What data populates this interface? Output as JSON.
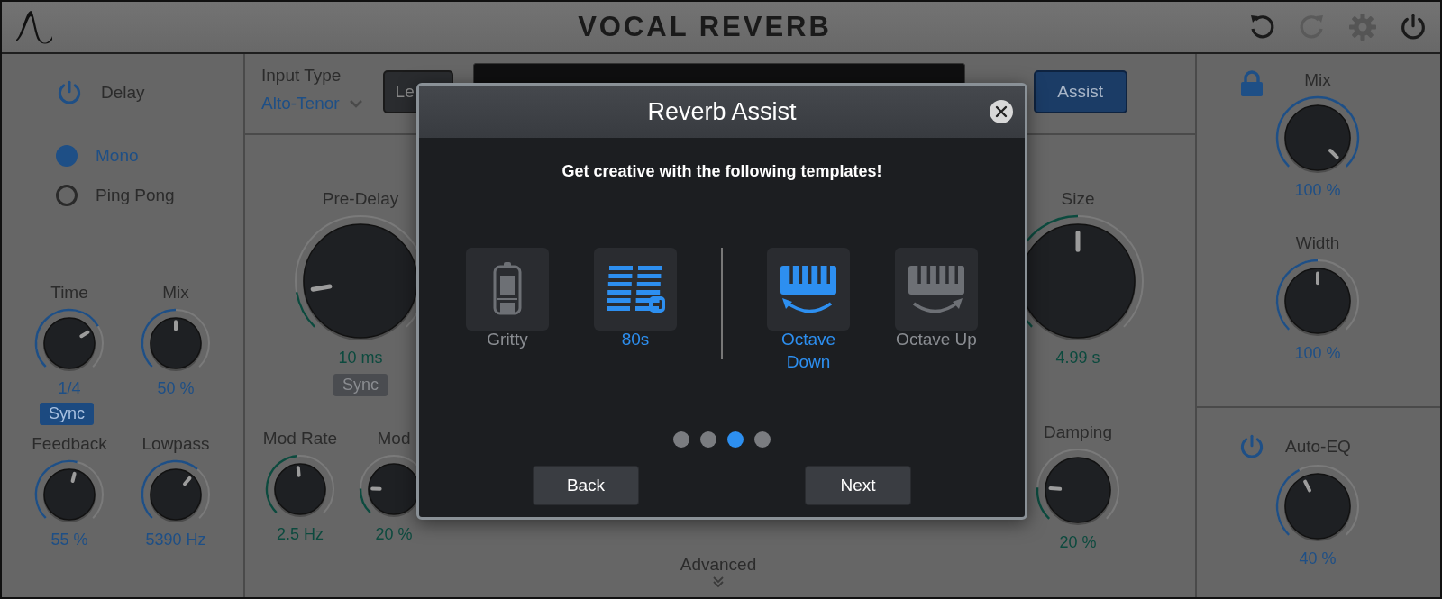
{
  "header": {
    "title": "VOCAL REVERB"
  },
  "delay": {
    "label": "Delay",
    "on": true,
    "modes": [
      {
        "label": "Mono",
        "selected": true
      },
      {
        "label": "Ping Pong",
        "selected": false
      }
    ],
    "knobs": [
      {
        "label": "Time",
        "value": "1/4"
      },
      {
        "label": "Mix",
        "value": "50 %"
      },
      {
        "label": "Feedback",
        "value": "55 %"
      },
      {
        "label": "Lowpass",
        "value": "5390 Hz"
      }
    ],
    "sync": {
      "label": "Sync",
      "on": true
    }
  },
  "input": {
    "label": "Input Type",
    "value": "Alto-Tenor",
    "learn": "Le",
    "assist": {
      "label": "Assist",
      "on": true
    }
  },
  "reverb": {
    "predelay": {
      "label": "Pre-Delay",
      "value": "10 ms"
    },
    "sync": {
      "label": "Sync",
      "on": false
    },
    "mod_knobs": [
      {
        "label": "Mod Rate",
        "value": "2.5 Hz"
      },
      {
        "label": "Mod",
        "value": "20 %"
      }
    ],
    "size": {
      "label": "Size",
      "value": "4.99 s"
    },
    "damping": {
      "label": "Damping",
      "value": "20 %"
    },
    "advanced": "Advanced"
  },
  "output": {
    "locked": true,
    "knobs": [
      {
        "label": "Mix",
        "value": "100 %"
      },
      {
        "label": "Width",
        "value": "100 %"
      }
    ],
    "auto_eq": {
      "label": "Auto-EQ",
      "on": true,
      "knob": {
        "value": "40 %"
      }
    }
  },
  "modal": {
    "title": "Reverb Assist",
    "subtitle": "Get creative with the following templates!",
    "templates": [
      {
        "label": "Gritty",
        "kind": "tube",
        "selected": false
      },
      {
        "label": "80s",
        "kind": "stripes",
        "selected": true
      },
      {
        "label": "Octave Down",
        "kind": "octave-down",
        "selected": true
      },
      {
        "label": "Octave Up",
        "kind": "octave-up",
        "selected": false
      }
    ],
    "pages": [
      {
        "selected": false
      },
      {
        "selected": false
      },
      {
        "selected": true
      },
      {
        "selected": false
      }
    ],
    "buttons": [
      "Back",
      "Next"
    ]
  }
}
